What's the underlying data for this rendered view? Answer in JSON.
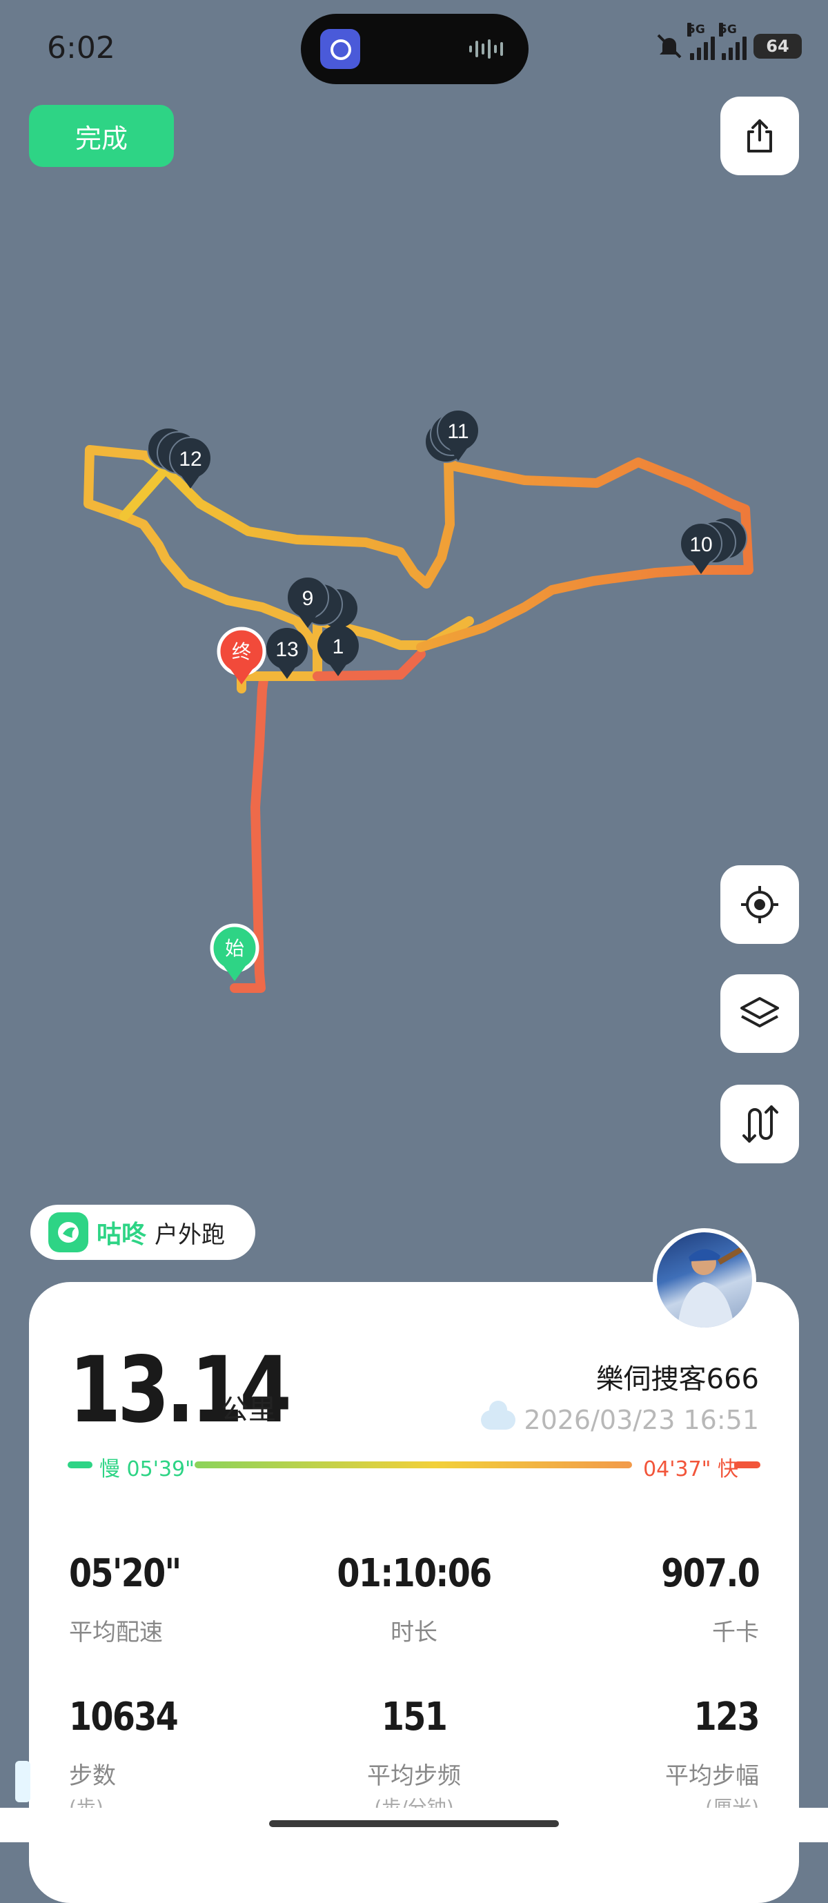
{
  "status_bar": {
    "time": "6:02",
    "network_1": "5G",
    "network_2": "5G",
    "battery": "64"
  },
  "top": {
    "done_label": "完成"
  },
  "map": {
    "start_label": "始",
    "end_label": "终",
    "km_markers": [
      "1",
      "9",
      "10",
      "11",
      "12",
      "13"
    ]
  },
  "brand": {
    "name": "咕咚",
    "activity": "户外跑"
  },
  "run": {
    "distance": "13.14",
    "distance_unit": "公里",
    "user_name": "樂伺捜客666",
    "datetime": "2026/03/23 16:51",
    "pace_slow": "慢 05'39\"",
    "pace_fast": "04'37\" 快"
  },
  "stats": [
    {
      "value": "05'20\"",
      "label": "平均配速"
    },
    {
      "value": "01:10:06",
      "label": "时长"
    },
    {
      "value": "907.0",
      "label": "千卡"
    },
    {
      "value": "10634",
      "label": "步数"
    },
    {
      "value": "151",
      "label": "平均步频"
    },
    {
      "value": "123",
      "label": "平均步幅"
    }
  ],
  "stats_units": [
    "(步)",
    "(步/分钟)",
    "(厘米)"
  ],
  "colors": {
    "accent": "#2ed485",
    "slow": "#2ed485",
    "fast": "#f2553a",
    "route_yellow": "#f2c534",
    "route_orange": "#ee7a3a",
    "map_bg": "#6b7b8d"
  },
  "icons": [
    "share-icon",
    "locate-icon",
    "layers-icon",
    "route-toggle-icon"
  ]
}
